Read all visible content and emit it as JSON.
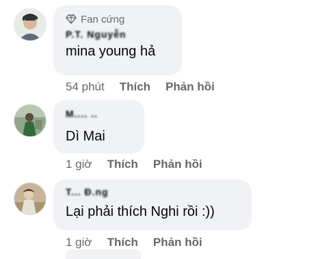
{
  "comments": [
    {
      "badge": "Fan cứng",
      "author": "P.T. Nguyễn",
      "text": "mina young hả",
      "time": "54 phút",
      "like": "Thích",
      "reply": "Phản hồi"
    },
    {
      "author": "M.... ..",
      "text": "Dì Mai",
      "time": "1 giờ",
      "like": "Thích",
      "reply": "Phản hồi"
    },
    {
      "author": "T... Đ.ng",
      "text": "Lại phải thích Nghi rồi :))",
      "time": "1 giờ",
      "like": "Thích",
      "reply": "Phản hồi"
    }
  ],
  "icons": {
    "badge": "diamond-icon"
  },
  "colors": {
    "bubble": "#f0f2f5",
    "meta": "#65676b",
    "text": "#050505"
  }
}
